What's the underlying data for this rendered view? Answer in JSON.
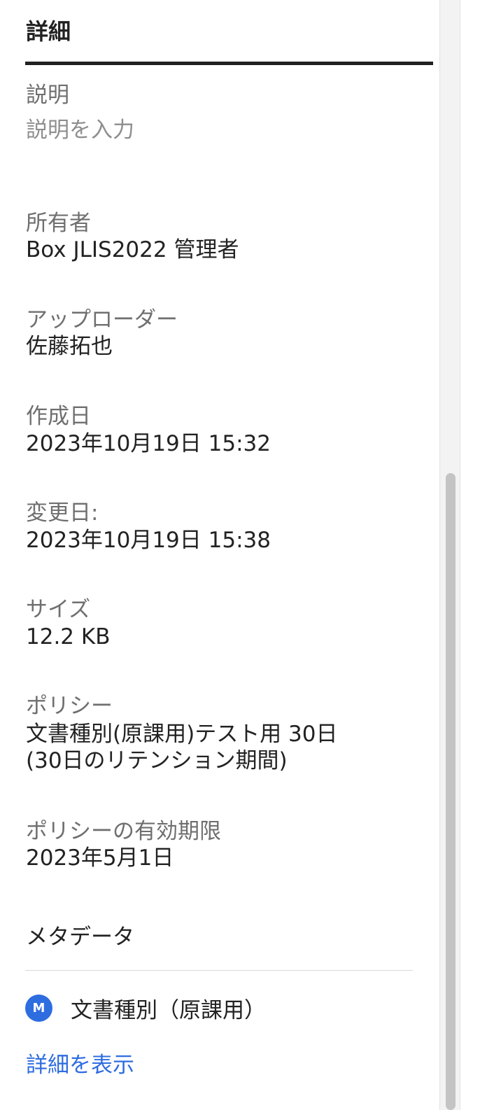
{
  "tab": {
    "title": "詳細"
  },
  "description": {
    "label": "説明",
    "placeholder": "説明を入力"
  },
  "owner": {
    "label": "所有者",
    "value": "Box JLIS2022 管理者"
  },
  "uploader": {
    "label": "アップローダー",
    "value": "佐藤拓也"
  },
  "created": {
    "label": "作成日",
    "value": "2023年10月19日 15:32"
  },
  "modified": {
    "label": "変更日:",
    "value": "2023年10月19日 15:38"
  },
  "size": {
    "label": "サイズ",
    "value": "12.2 KB"
  },
  "policy": {
    "label": "ポリシー",
    "value_line1": "文書種別(原課用)テスト用 30日",
    "value_line2": "(30日のリテンション期間)"
  },
  "policy_expiry": {
    "label": "ポリシーの有効期限",
    "value": "2023年5月1日"
  },
  "metadata": {
    "section_title": "メタデータ",
    "badge_letter": "M",
    "badge_icon": "metadata-template-icon",
    "template_name": "文書種別（原課用）",
    "show_details_link": "詳細を表示"
  },
  "colors": {
    "accent": "#2e6de0",
    "text": "#222222",
    "label": "#6f6f6f"
  }
}
